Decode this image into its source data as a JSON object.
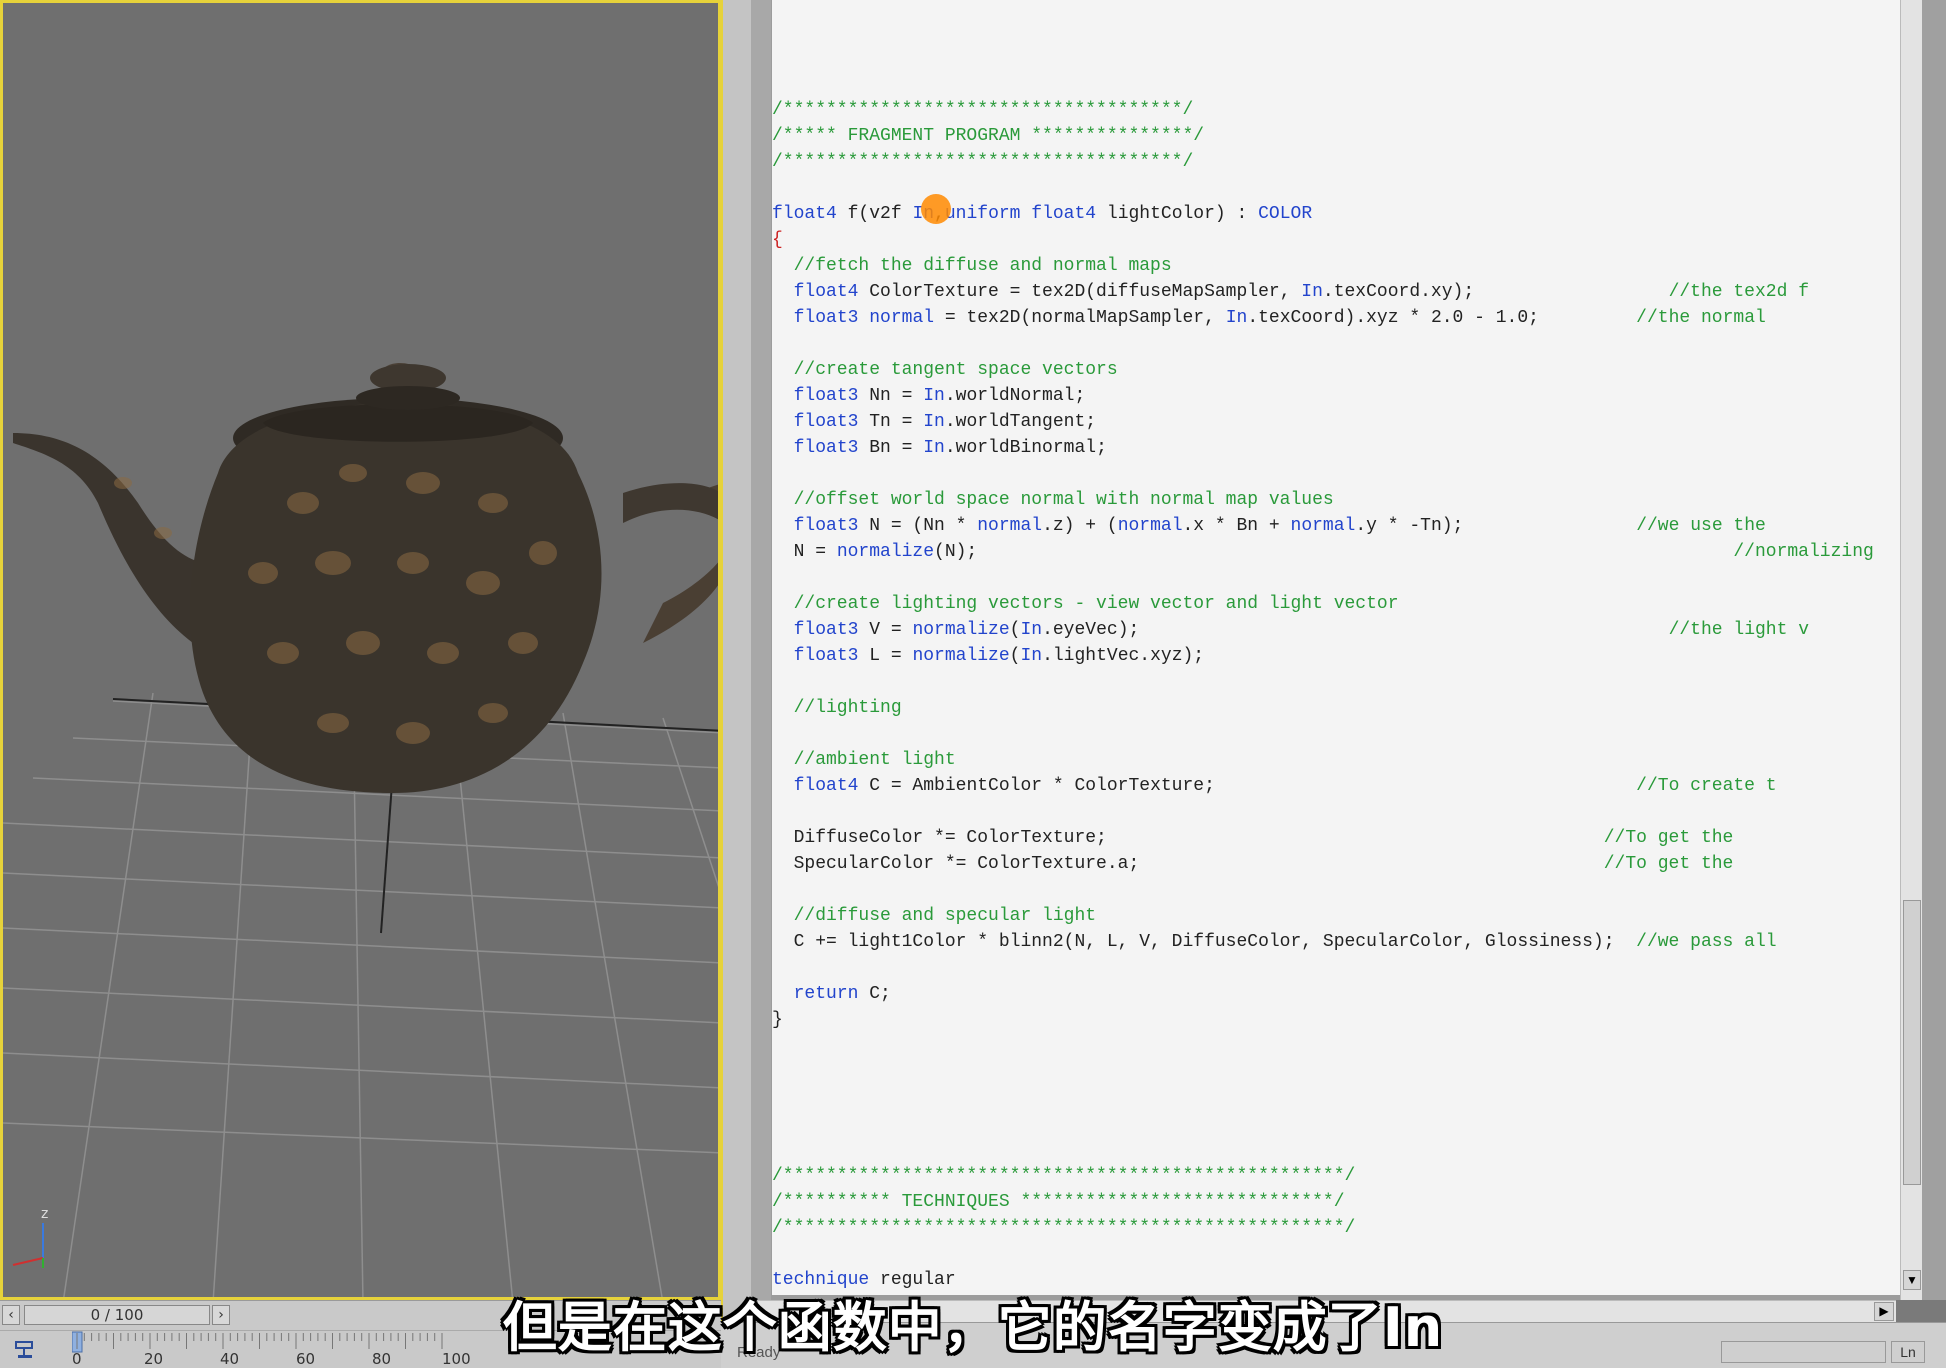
{
  "viewport": {
    "axis_label": "z",
    "time_display": "0 / 100",
    "track_ticks": [
      "0",
      "20",
      "40",
      "60",
      "80",
      "100"
    ],
    "colors": {
      "background": "#6f6f6f",
      "border": "#e6d23a",
      "teapot": "#3a342c"
    }
  },
  "editor": {
    "lines": [
      [
        {
          "t": "/*************************************/",
          "c": "cm"
        }
      ],
      [
        {
          "t": "/***** FRAGMENT PROGRAM ***************/",
          "c": "cm"
        }
      ],
      [
        {
          "t": "/*************************************/",
          "c": "cm"
        }
      ],
      [],
      [
        {
          "t": "float4",
          "c": "kw"
        },
        {
          "t": " f(v2f "
        },
        {
          "t": "In",
          "c": "kw"
        },
        {
          "t": ","
        },
        {
          "t": "uniform float4",
          "c": "kw"
        },
        {
          "t": " lightColor) : "
        },
        {
          "t": "COLOR",
          "c": "kw"
        }
      ],
      [
        {
          "t": "{",
          "c": "red"
        }
      ],
      [
        {
          "t": "  //fetch the diffuse and normal maps",
          "c": "cm"
        }
      ],
      [
        {
          "t": "  "
        },
        {
          "t": "float4",
          "c": "kw"
        },
        {
          "t": " ColorTexture = tex2D(diffuseMapSampler, "
        },
        {
          "t": "In",
          "c": "kw"
        },
        {
          "t": ".texCoord.xy);"
        },
        {
          "t": "                  //the tex2d f",
          "c": "cm"
        }
      ],
      [
        {
          "t": "  "
        },
        {
          "t": "float3",
          "c": "kw"
        },
        {
          "t": " "
        },
        {
          "t": "normal",
          "c": "kw"
        },
        {
          "t": " = tex2D(normalMapSampler, "
        },
        {
          "t": "In",
          "c": "kw"
        },
        {
          "t": ".texCoord).xyz * 2.0 - 1.0;"
        },
        {
          "t": "         //the normal",
          "c": "cm"
        }
      ],
      [],
      [
        {
          "t": "  //create tangent space vectors",
          "c": "cm"
        }
      ],
      [
        {
          "t": "  "
        },
        {
          "t": "float3",
          "c": "kw"
        },
        {
          "t": " Nn = "
        },
        {
          "t": "In",
          "c": "kw"
        },
        {
          "t": ".worldNormal;"
        }
      ],
      [
        {
          "t": "  "
        },
        {
          "t": "float3",
          "c": "kw"
        },
        {
          "t": " Tn = "
        },
        {
          "t": "In",
          "c": "kw"
        },
        {
          "t": ".worldTangent;"
        }
      ],
      [
        {
          "t": "  "
        },
        {
          "t": "float3",
          "c": "kw"
        },
        {
          "t": " Bn = "
        },
        {
          "t": "In",
          "c": "kw"
        },
        {
          "t": ".worldBinormal;"
        }
      ],
      [],
      [
        {
          "t": "  //offset world space normal with normal map values",
          "c": "cm"
        }
      ],
      [
        {
          "t": "  "
        },
        {
          "t": "float3",
          "c": "kw"
        },
        {
          "t": " N = (Nn * "
        },
        {
          "t": "normal",
          "c": "kw"
        },
        {
          "t": ".z) + ("
        },
        {
          "t": "normal",
          "c": "kw"
        },
        {
          "t": ".x * Bn + "
        },
        {
          "t": "normal",
          "c": "kw"
        },
        {
          "t": ".y * -Tn);"
        },
        {
          "t": "                //we use the",
          "c": "cm"
        }
      ],
      [
        {
          "t": "  N = "
        },
        {
          "t": "normalize",
          "c": "kw"
        },
        {
          "t": "(N);"
        },
        {
          "t": "                                                                      //normalizing",
          "c": "cm"
        }
      ],
      [],
      [
        {
          "t": "  //create lighting vectors - view vector and light vector",
          "c": "cm"
        }
      ],
      [
        {
          "t": "  "
        },
        {
          "t": "float3",
          "c": "kw"
        },
        {
          "t": " V = "
        },
        {
          "t": "normalize",
          "c": "kw"
        },
        {
          "t": "("
        },
        {
          "t": "In",
          "c": "kw"
        },
        {
          "t": ".eyeVec);"
        },
        {
          "t": "                                                 //the light v",
          "c": "cm"
        }
      ],
      [
        {
          "t": "  "
        },
        {
          "t": "float3",
          "c": "kw"
        },
        {
          "t": " L = "
        },
        {
          "t": "normalize",
          "c": "kw"
        },
        {
          "t": "("
        },
        {
          "t": "In",
          "c": "kw"
        },
        {
          "t": ".lightVec.xyz);"
        }
      ],
      [],
      [
        {
          "t": "  //lighting",
          "c": "cm"
        }
      ],
      [],
      [
        {
          "t": "  //ambient light",
          "c": "cm"
        }
      ],
      [
        {
          "t": "  "
        },
        {
          "t": "float4",
          "c": "kw"
        },
        {
          "t": " C = AmbientColor * ColorTexture;"
        },
        {
          "t": "                                       //To create t",
          "c": "cm"
        }
      ],
      [],
      [
        {
          "t": "  DiffuseColor *= ColorTexture;"
        },
        {
          "t": "                                              //To get the",
          "c": "cm"
        }
      ],
      [
        {
          "t": "  SpecularColor *= ColorTexture.a;"
        },
        {
          "t": "                                           //To get the",
          "c": "cm"
        }
      ],
      [],
      [
        {
          "t": "  //diffuse and specular light",
          "c": "cm"
        }
      ],
      [
        {
          "t": "  C += light1Color * blinn2(N, L, V, DiffuseColor, SpecularColor, Glossiness);  "
        },
        {
          "t": "//we pass all",
          "c": "cm"
        }
      ],
      [],
      [
        {
          "t": "  "
        },
        {
          "t": "return",
          "c": "kw"
        },
        {
          "t": " C;"
        }
      ],
      [
        {
          "t": "}"
        }
      ],
      [],
      [],
      [],
      [],
      [],
      [
        {
          "t": "/****************************************************/",
          "c": "cm"
        }
      ],
      [
        {
          "t": "/********** TECHNIQUES *****************************/",
          "c": "cm"
        }
      ],
      [
        {
          "t": "/****************************************************/",
          "c": "cm"
        }
      ],
      [],
      [
        {
          "t": "technique",
          "c": "kw"
        },
        {
          "t": " regular"
        }
      ]
    ]
  },
  "statusbar": {
    "status": "Ready",
    "position": "Ln"
  },
  "subtitle": "但是在这个函数中，它的名字变成了In"
}
